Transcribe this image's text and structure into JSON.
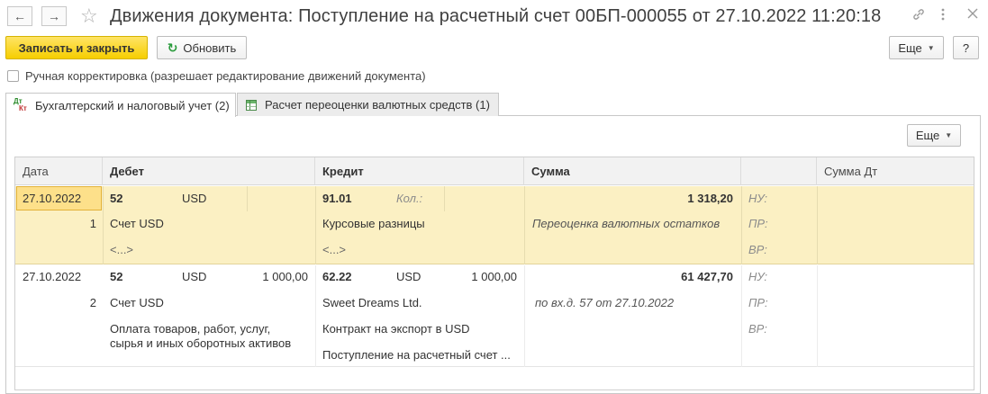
{
  "window": {
    "title": "Движения документа: Поступление на расчетный счет 00БП-000055 от 27.10.2022 11:20:18",
    "nav_back": "←",
    "nav_forward": "→",
    "favorite_glyph": "☆",
    "link_glyph": "🔗",
    "menu_glyph": "⋮",
    "close_glyph": "✕"
  },
  "toolbar": {
    "save_close": "Записать и закрыть",
    "refresh": "Обновить",
    "more": "Еще",
    "help": "?"
  },
  "manual_correction": {
    "label": "Ручная корректировка (разрешает редактирование движений документа)",
    "checked": false
  },
  "tabs": [
    {
      "label": "Бухгалтерский и налоговый учет (2)",
      "icon": "accounting-dt-kt-icon",
      "active": true
    },
    {
      "label": "Расчет переоценки валютных средств (1)",
      "icon": "table-icon",
      "active": false
    }
  ],
  "table": {
    "more_button": "Еще",
    "columns": {
      "date": "Дата",
      "debit": "Дебет",
      "credit": "Кредит",
      "sum": "Сумма",
      "sum_dt": "Сумма Дт"
    },
    "rows": [
      {
        "date": "27.10.2022",
        "number": "1",
        "debit_account": "52",
        "debit_currency": "USD",
        "debit_amount": "",
        "debit_sub1": "Счет USD",
        "debit_sub2": "<...>",
        "credit_account": "91.01",
        "credit_qty_label": "Кол.:",
        "credit_sub1": "Курсовые разницы",
        "credit_sub2": "<...>",
        "sum": "1 318,20",
        "content": "Переоценка валютных остатков",
        "nu": "НУ:",
        "pr": "ПР:",
        "vr": "ВР:"
      },
      {
        "date": "27.10.2022",
        "number": "2",
        "debit_account": "52",
        "debit_currency": "USD",
        "debit_amount": "1 000,00",
        "debit_sub1": "Счет USD",
        "debit_sub2_line1": "Оплата товаров, работ, услуг,",
        "debit_sub2_line2": "сырья и иных оборотных активов",
        "credit_account": "62.22",
        "credit_currency": "USD",
        "credit_amount": "1 000,00",
        "credit_sub1": "Sweet Dreams Ltd.",
        "credit_sub2": "Контракт на экспорт в USD",
        "credit_sub3": "Поступление на расчетный счет ...",
        "sum": "61 427,70",
        "content": "по вх.д. 57 от 27.10.2022",
        "nu": "НУ:",
        "pr": "ПР:",
        "vr": "ВР:"
      }
    ]
  }
}
